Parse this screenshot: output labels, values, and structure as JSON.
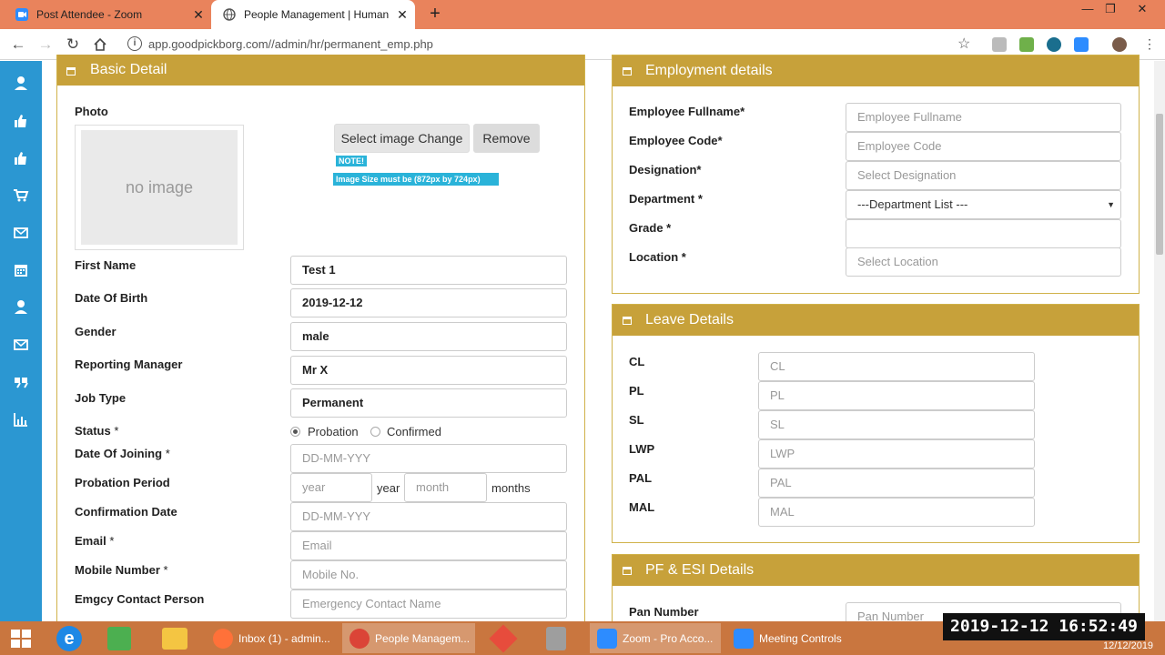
{
  "browser": {
    "tabs": [
      {
        "label": "Post Attendee - Zoom",
        "close": "✕"
      },
      {
        "label": "People Management | Human Re",
        "close": "✕"
      }
    ],
    "new_tab": "+",
    "url": "app.goodpickborg.com//admin/hr/permanent_emp.php",
    "window_controls": {
      "minimize": "—",
      "maximize": "❐",
      "close": "✕"
    }
  },
  "basic": {
    "header": "Basic Detail",
    "photo_label": "Photo",
    "no_image": "no image",
    "select_image": "Select image Change",
    "remove": "Remove",
    "note": "NOTE!",
    "note_size": "Image Size must be (872px by 724px)",
    "fields": {
      "first_name": {
        "label": "First Name",
        "value": "Test 1"
      },
      "dob": {
        "label": "Date Of Birth",
        "value": "2019-12-12"
      },
      "gender": {
        "label": "Gender",
        "value": "male"
      },
      "reporting_manager": {
        "label": "Reporting Manager",
        "value": "Mr X"
      },
      "job_type": {
        "label": "Job Type",
        "value": "Permanent"
      },
      "status": {
        "label": "Status",
        "req": "*",
        "options": [
          "Probation",
          "Confirmed"
        ],
        "selected": "Probation"
      },
      "doj": {
        "label": "Date Of Joining",
        "req": "*",
        "placeholder": "DD-MM-YYY"
      },
      "probation": {
        "label": "Probation Period",
        "year_ph": "year",
        "year_suffix": "year",
        "month_ph": "month",
        "month_suffix": "months"
      },
      "confirmation": {
        "label": "Confirmation Date",
        "placeholder": "DD-MM-YYY"
      },
      "email": {
        "label": "Email",
        "req": "*",
        "placeholder": "Email"
      },
      "mobile": {
        "label": "Mobile Number",
        "req": "*",
        "placeholder": "Mobile No."
      },
      "emergency": {
        "label": "Emgcy Contact Person",
        "placeholder": "Emergency Contact Name"
      }
    }
  },
  "employment": {
    "header": "Employment details",
    "fields": [
      {
        "label": "Employee Fullname*",
        "placeholder": "Employee Fullname"
      },
      {
        "label": "Employee Code*",
        "placeholder": "Employee Code"
      },
      {
        "label": "Designation*",
        "placeholder": "Select Designation"
      },
      {
        "label": "Department *",
        "placeholder": "---Department List ---"
      },
      {
        "label": "Grade *",
        "placeholder": ""
      },
      {
        "label": "Location *",
        "placeholder": "Select Location"
      }
    ]
  },
  "leave": {
    "header": "Leave Details",
    "fields": [
      {
        "label": "CL",
        "placeholder": "CL"
      },
      {
        "label": "PL",
        "placeholder": "PL"
      },
      {
        "label": "SL",
        "placeholder": "SL"
      },
      {
        "label": "LWP",
        "placeholder": "LWP"
      },
      {
        "label": "PAL",
        "placeholder": "PAL"
      },
      {
        "label": "MAL",
        "placeholder": "MAL"
      }
    ]
  },
  "pf": {
    "header": "PF & ESI Details",
    "pan_label": "Pan Number",
    "pan_placeholder": "Pan Number"
  },
  "taskbar": {
    "items": [
      "Inbox (1) - admin...",
      "People Managem...",
      "Zoom - Pro Acco...",
      "Meeting Controls"
    ],
    "clock": "2019-12-12  16:52:49",
    "date": "12/12/2019"
  },
  "colors": {
    "tabbar": "#e9835c",
    "sidebar": "#2b97d2",
    "panel_header": "#c7a13a",
    "taskbar": "#c9763f"
  }
}
